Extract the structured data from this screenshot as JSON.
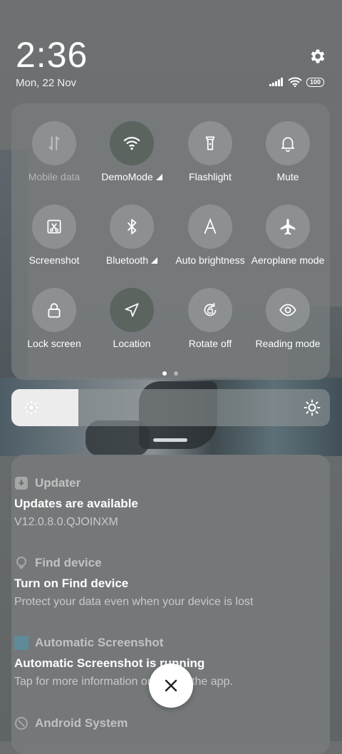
{
  "status": {
    "time": "2:36",
    "date": "Mon, 22 Nov",
    "battery": "100"
  },
  "quick_settings": {
    "tiles": [
      {
        "label": "Mobile data",
        "icon": "mobile-data-icon",
        "state": "unavailable"
      },
      {
        "label": "DemoMode",
        "icon": "wifi-icon",
        "state": "on"
      },
      {
        "label": "Flashlight",
        "icon": "flashlight-icon",
        "state": "off"
      },
      {
        "label": "Mute",
        "icon": "bell-icon",
        "state": "off"
      },
      {
        "label": "Screenshot",
        "icon": "screenshot-icon",
        "state": "off"
      },
      {
        "label": "Bluetooth",
        "icon": "bluetooth-icon",
        "state": "off"
      },
      {
        "label": "Auto brightness",
        "icon": "auto-brightness-icon",
        "state": "off"
      },
      {
        "label": "Aeroplane mode",
        "icon": "airplane-icon",
        "state": "off"
      },
      {
        "label": "Lock screen",
        "icon": "lock-icon",
        "state": "off"
      },
      {
        "label": "Location",
        "icon": "location-icon",
        "state": "on"
      },
      {
        "label": "Rotate off",
        "icon": "rotate-icon",
        "state": "off"
      },
      {
        "label": "Reading mode",
        "icon": "eye-icon",
        "state": "off"
      }
    ],
    "page_count": 2,
    "current_page": 1
  },
  "brightness": {
    "level": 0.21
  },
  "notifications": [
    {
      "app": "Updater",
      "title": "Updates are available",
      "body": "V12.0.8.0.QJOINXM"
    },
    {
      "app": "Find device",
      "title": "Turn on Find device",
      "body": "Protect your data even when your device is lost"
    },
    {
      "app": "Automatic Screenshot",
      "title": "Automatic Screenshot is running",
      "body": "Tap for more information or to stop the app."
    },
    {
      "app": "Android System",
      "title": "",
      "body": ""
    }
  ],
  "colors": {
    "panel": "#787c7d",
    "active_tile": "#58605c",
    "brightness_fill": "#ececec"
  }
}
